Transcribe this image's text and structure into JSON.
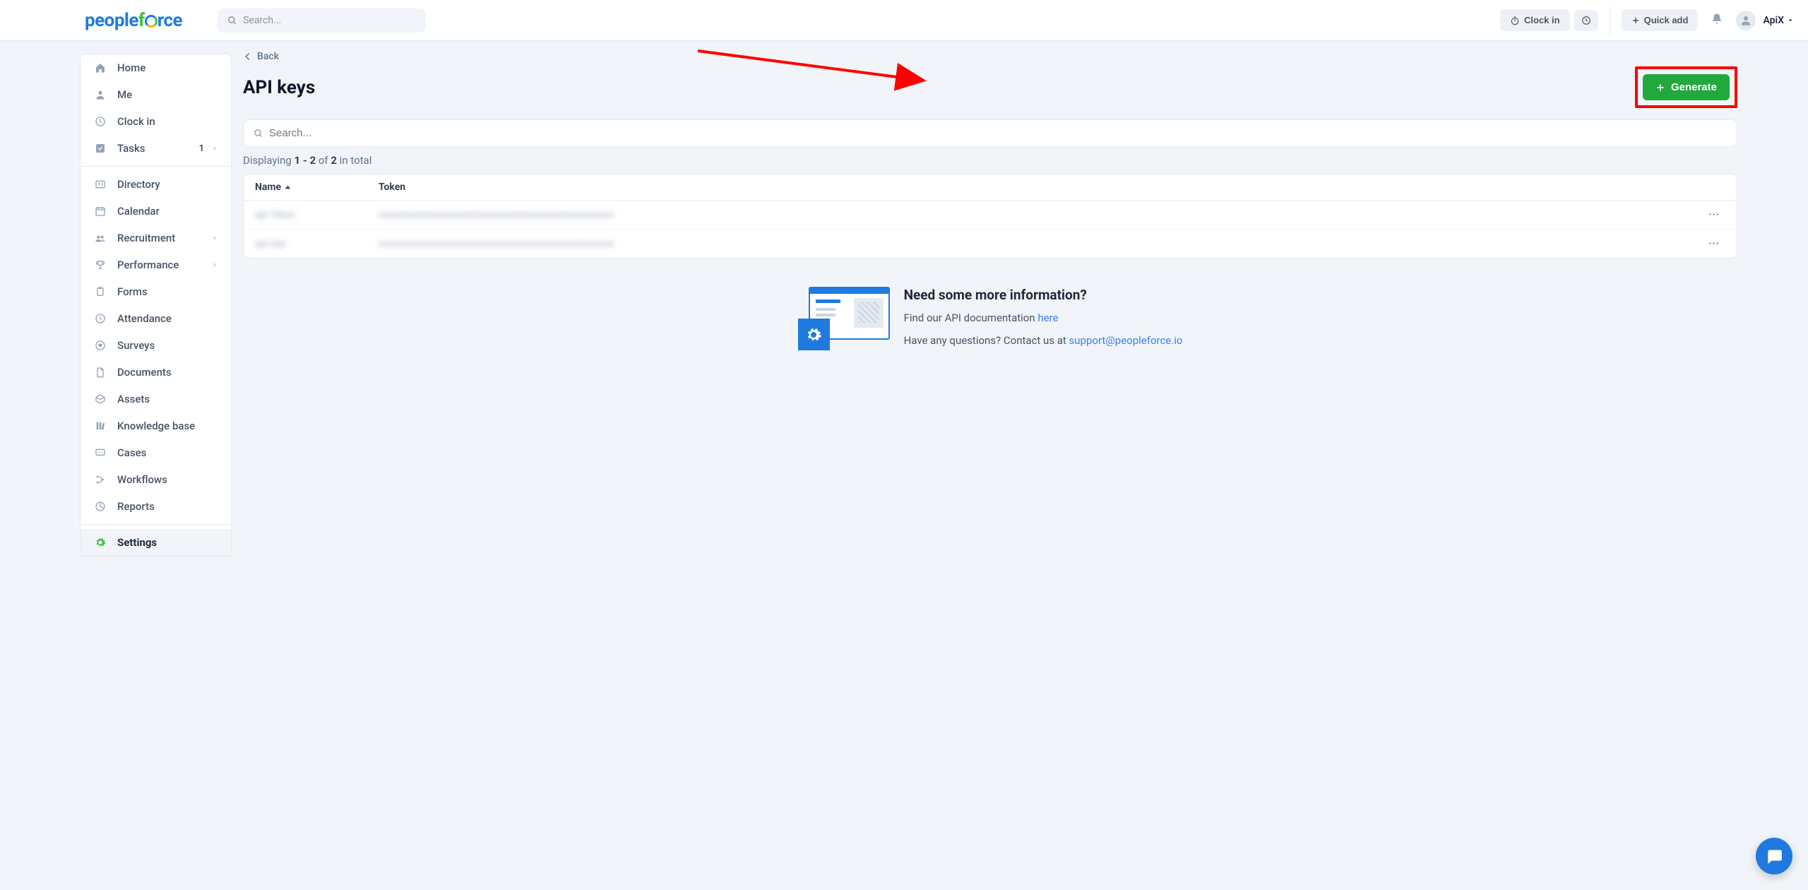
{
  "header": {
    "logo_part1": "people",
    "logo_part2": "f",
    "logo_part3": "rce",
    "search_placeholder": "Search...",
    "clock_in": "Clock in",
    "quick_add": "Quick add",
    "username": "ApiX"
  },
  "sidebar": {
    "items": [
      {
        "label": "Home",
        "icon": "home"
      },
      {
        "label": "Me",
        "icon": "user"
      },
      {
        "label": "Clock in",
        "icon": "clock"
      },
      {
        "label": "Tasks",
        "icon": "check",
        "badge": "1",
        "chev": true
      }
    ],
    "items2": [
      {
        "label": "Directory",
        "icon": "id"
      },
      {
        "label": "Calendar",
        "icon": "cal"
      },
      {
        "label": "Recruitment",
        "icon": "group",
        "chev": true
      },
      {
        "label": "Performance",
        "icon": "trophy",
        "chev": true
      },
      {
        "label": "Forms",
        "icon": "clip"
      },
      {
        "label": "Attendance",
        "icon": "clock"
      },
      {
        "label": "Surveys",
        "icon": "heart"
      },
      {
        "label": "Documents",
        "icon": "doc"
      },
      {
        "label": "Assets",
        "icon": "box"
      },
      {
        "label": "Knowledge base",
        "icon": "books"
      },
      {
        "label": "Cases",
        "icon": "chat"
      },
      {
        "label": "Workflows",
        "icon": "flow"
      },
      {
        "label": "Reports",
        "icon": "pie"
      }
    ],
    "settings_label": "Settings"
  },
  "page": {
    "back": "Back",
    "title": "API keys",
    "generate": "Generate",
    "search_placeholder": "Search...",
    "count_prefix": "Displaying ",
    "count_range": "1 - 2",
    "count_of": " of ",
    "count_total": "2",
    "count_suffix": " in total",
    "th_name": "Name",
    "th_token": "Token",
    "rows": [
      {
        "name": "api token",
        "token": "xxxxxxxxxxxxxxxxxxxxxxxxxxxxxxxxxxxxxxxxxxxxxxxx"
      },
      {
        "name": "api key",
        "token": "xxxxxxxxxxxxxxxxxxxxxxxxxxxxxxxxxxxxxxxxxxxxxxxx"
      }
    ]
  },
  "info": {
    "title": "Need some more information?",
    "line1_pre": "Find our API documentation ",
    "line1_link": "here",
    "line2_pre": "Have any questions? Contact us at ",
    "line2_link": "support@peopleforce.io"
  }
}
